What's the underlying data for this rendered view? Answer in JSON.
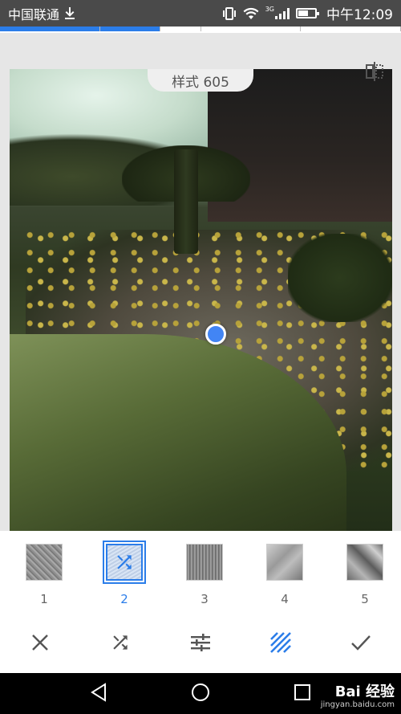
{
  "status_bar": {
    "carrier": "中国联通",
    "network": "3G",
    "time": "中午12:09",
    "icons": [
      "download-icon",
      "vibrate-icon",
      "wifi-icon",
      "signal-icon",
      "battery-icon"
    ]
  },
  "progress": {
    "segments": 4,
    "active_segments": 2
  },
  "preview": {
    "style_label": "样式 605",
    "icons": [
      "compare-icon"
    ]
  },
  "styles": [
    {
      "number": "1",
      "selected": false
    },
    {
      "number": "2",
      "selected": true,
      "icon": "shuffle-icon"
    },
    {
      "number": "3",
      "selected": false
    },
    {
      "number": "4",
      "selected": false
    },
    {
      "number": "5",
      "selected": false
    }
  ],
  "toolbar": {
    "icons": [
      "close-icon",
      "shuffle-icon",
      "adjust-icon",
      "texture-icon",
      "check-icon"
    ],
    "active": "texture-icon",
    "accent_color": "#2b7de9"
  },
  "nav": {
    "icons": [
      "back-icon",
      "home-icon",
      "recents-icon"
    ]
  },
  "watermark": {
    "brand": "Bai 经验",
    "url": "jingyan.baidu.com"
  }
}
